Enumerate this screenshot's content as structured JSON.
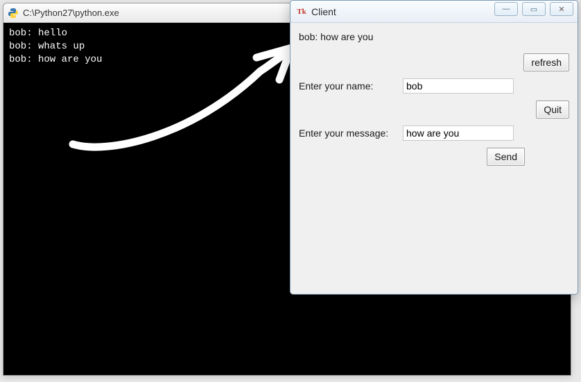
{
  "console": {
    "title": "C:\\Python27\\python.exe",
    "lines": [
      "bob: hello",
      "bob: whats up",
      "bob: how are you"
    ]
  },
  "client": {
    "title": "Client",
    "display_message": "bob: how are you",
    "labels": {
      "name": "Enter your name:",
      "message": "Enter your message:"
    },
    "inputs": {
      "name": "bob",
      "message": "how are you"
    },
    "buttons": {
      "refresh": "refresh",
      "quit": "Quit",
      "send": "Send"
    },
    "window_controls": {
      "minimize": "—",
      "maximize": "▭",
      "close": "✕"
    }
  }
}
